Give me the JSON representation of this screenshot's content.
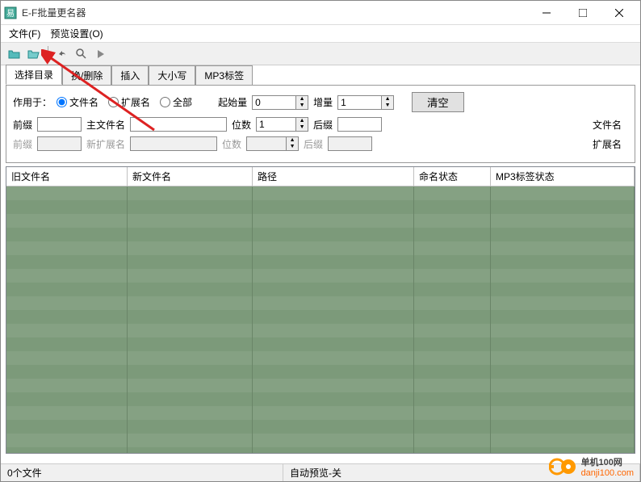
{
  "window": {
    "title": "E-F批量更名器"
  },
  "menu": {
    "file": "文件(F)",
    "preview": "预览设置(O)"
  },
  "tabs": {
    "select_dir": "选择目录",
    "replace_delete": "换/删除",
    "insert": "插入",
    "case": "大小写",
    "mp3_tag": "MP3标签"
  },
  "form": {
    "apply_to": "作用于：",
    "radio_filename": "文件名",
    "radio_ext": "扩展名",
    "radio_all": "全部",
    "start_num": "起始量",
    "start_val": "0",
    "increment": "增量",
    "increment_val": "1",
    "clear_btn": "清空",
    "side_filename": "文件名",
    "prefix": "前缀",
    "main_filename": "主文件名",
    "digits": "位数",
    "digits_val": "1",
    "suffix": "后缀",
    "side_ext": "扩展名",
    "prefix2": "前缀",
    "new_ext": "新扩展名",
    "digits2": "位数",
    "suffix2": "后缀"
  },
  "table": {
    "headers": {
      "old_name": "旧文件名",
      "new_name": "新文件名",
      "path": "路径",
      "rename_status": "命名状态",
      "mp3_status": "MP3标签状态"
    }
  },
  "status": {
    "files": "0个文件",
    "preview": "自动预览-关"
  },
  "watermark": {
    "brand": "单机100网",
    "url": "danji100.com"
  }
}
